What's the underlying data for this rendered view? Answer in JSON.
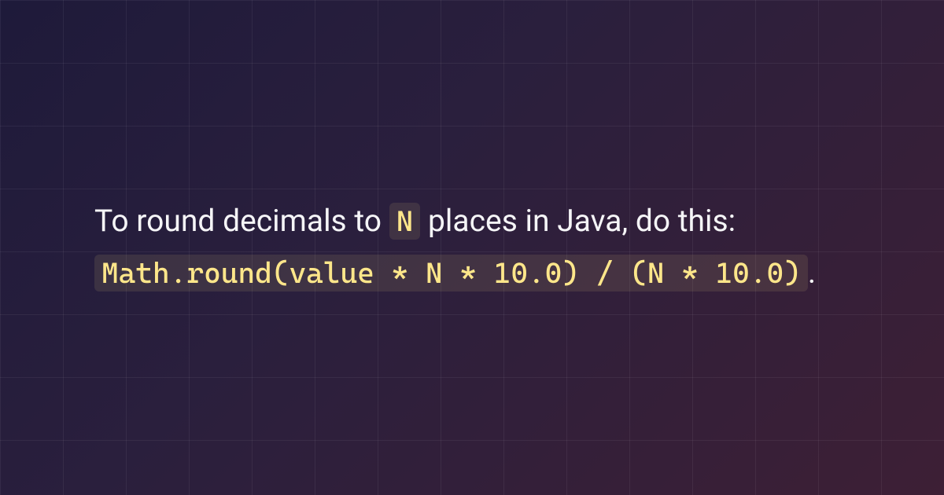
{
  "text": {
    "part1": "To round decimals to ",
    "code1": "N",
    "part2": " places in Java, do this: ",
    "code2": "Math.round(value * N * 10.0) / (N * 10.0)",
    "part3": "."
  }
}
